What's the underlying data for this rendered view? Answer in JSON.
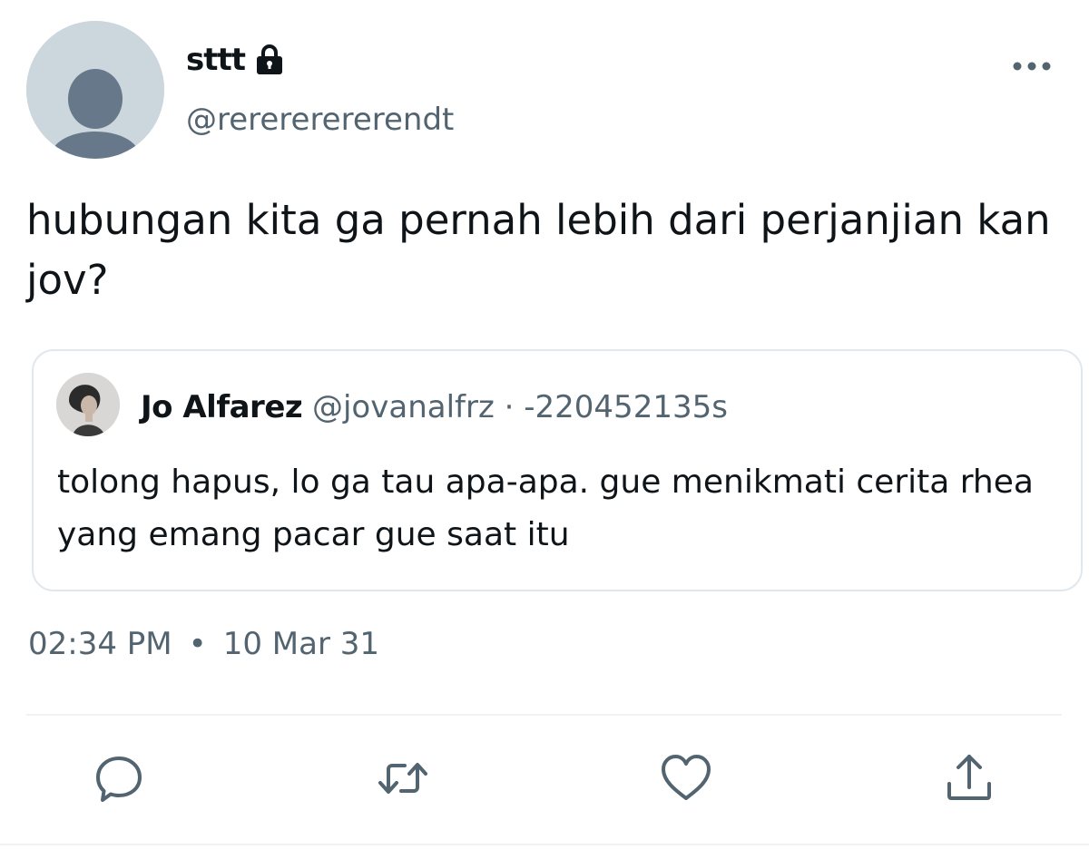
{
  "author": {
    "display_name": "sttt",
    "handle": "@rerererererendt",
    "avatar": "default-avatar",
    "protected_icon": "lock-icon"
  },
  "menu": {
    "icon": "more-dots-icon"
  },
  "tweet": {
    "text": "hubungan kita ga pernah lebih dari perjanjian kan jov?"
  },
  "quote": {
    "avatar": "profile-photo",
    "name": "Jo Alfarez",
    "handle": "@jovanalfrz",
    "separator": "·",
    "time": "-220452135s",
    "text": "tolong hapus, lo ga tau apa-apa. gue menikmati cerita rhea yang emang pacar gue saat itu"
  },
  "timestamp": {
    "time": "02:34 PM",
    "separator": "•",
    "date": "10 Mar 31"
  },
  "actions": [
    {
      "icon": "reply-icon"
    },
    {
      "icon": "retweet-icon"
    },
    {
      "icon": "like-icon"
    },
    {
      "icon": "share-icon"
    }
  ],
  "colors": {
    "primary_text": "#0f1419",
    "secondary_text": "#536471",
    "border": "#e1e8ed",
    "icon": "#536471",
    "avatar_bg": "#ccd6dd",
    "avatar_fg": "#66788a"
  }
}
